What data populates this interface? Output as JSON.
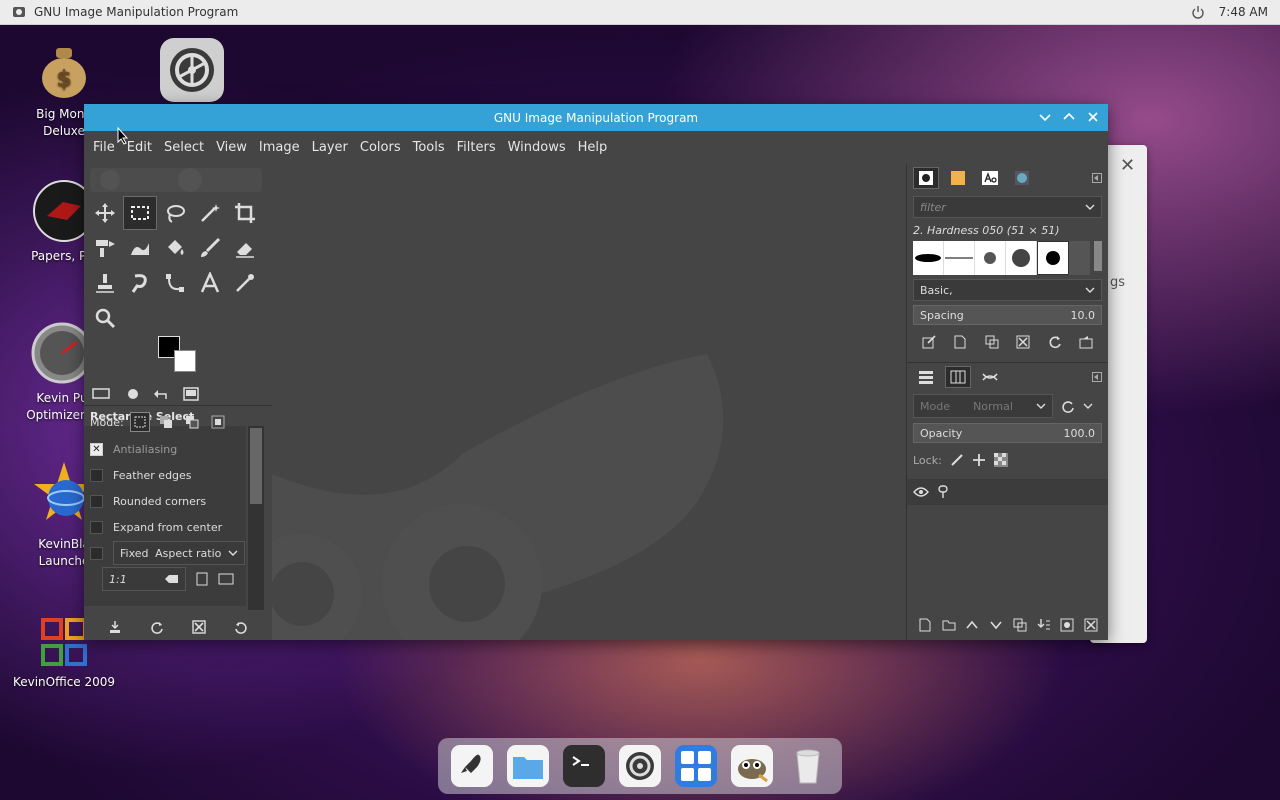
{
  "topbar": {
    "app_name": "GNU Image Manipulation Program",
    "time": "7:48 AM"
  },
  "desktop": {
    "items": [
      {
        "label_line1": "Big Mone",
        "label_line2": "Deluxe"
      },
      {
        "label_line1": "Papers, Ple",
        "label_line2": ""
      },
      {
        "label_line1": "Kevin Pu",
        "label_line2": "Optimizer H"
      },
      {
        "label_line1": "KevinBla",
        "label_line2": "Launche"
      },
      {
        "label_line1": "KevinOffice 2009",
        "label_line2": ""
      }
    ]
  },
  "background_dialog": {
    "peek_text": "gs"
  },
  "window": {
    "title": "GNU Image Manipulation Program",
    "menus": [
      "File",
      "Edit",
      "Select",
      "View",
      "Image",
      "Layer",
      "Colors",
      "Tools",
      "Filters",
      "Windows",
      "Help"
    ]
  },
  "tool_options": {
    "title": "Rectangle Select",
    "mode_label": "Mode:",
    "antialiasing": "Antialiasing",
    "feather_edges": "Feather edges",
    "rounded_corners": "Rounded corners",
    "expand_from_center": "Expand from center",
    "fixed": "Fixed",
    "aspect_ratio": "Aspect ratio",
    "ratio_value": "1:1"
  },
  "brushes": {
    "filter_placeholder": "filter",
    "brush_name": "2. Hardness 050 (51 × 51)",
    "tag": "Basic,",
    "spacing_label": "Spacing",
    "spacing_value": "10.0"
  },
  "layers": {
    "mode_label": "Mode",
    "mode_value": "Normal",
    "opacity_label": "Opacity",
    "opacity_value": "100.0",
    "lock_label": "Lock:"
  },
  "colors": {
    "titlebar": "#34a2d6",
    "panel": "#454545",
    "canvas_bg": "#454545"
  }
}
